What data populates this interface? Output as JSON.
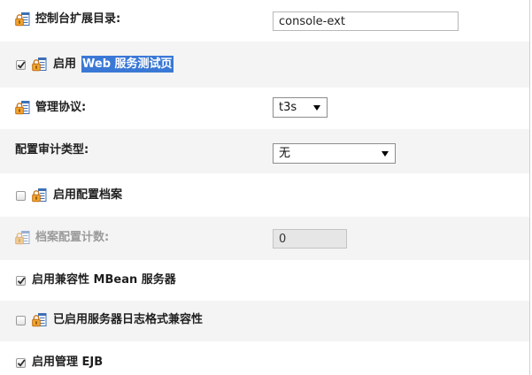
{
  "settings": {
    "console_ext_dir": {
      "icon": "restart-required-icon",
      "label": "控制台扩展目录:",
      "value": "console-ext"
    },
    "web_service_test_page": {
      "checked": true,
      "icon": "restart-required-icon",
      "label": "启用",
      "label_selected": "Web 服务测试页"
    },
    "admin_protocol": {
      "icon": "restart-required-icon",
      "label": "管理协议:",
      "value": "t3s"
    },
    "config_audit_type": {
      "label": "配置审计类型:",
      "value": "无"
    },
    "config_archive": {
      "checked": false,
      "icon": "restart-required-icon",
      "label": "启用配置档案"
    },
    "archive_config_count": {
      "icon": "restart-required-icon",
      "label": "档案配置计数:",
      "value": "0",
      "disabled": true
    },
    "compat_mbean_server": {
      "checked": true,
      "label": "启用兼容性 MBean 服务器"
    },
    "log_format_compat": {
      "checked": false,
      "icon": "restart-required-icon",
      "label": "已启用服务器日志格式兼容性"
    },
    "management_ejb": {
      "checked": true,
      "label": "启用管理 EJB"
    }
  },
  "colors": {
    "row_alt": "#f4f4f4",
    "selection_highlight": "#3a78d6",
    "icon_lock": "#f0a530",
    "icon_document": "#3d6fb5",
    "disabled_text": "#9a9a9a"
  }
}
